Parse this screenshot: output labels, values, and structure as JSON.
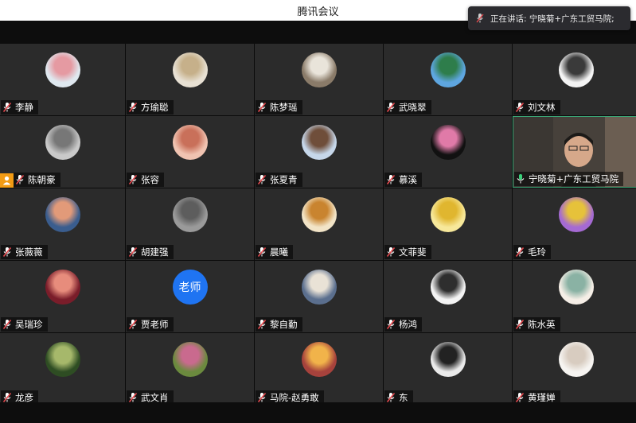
{
  "window": {
    "title": "腾讯会议"
  },
  "speaking": {
    "text": "正在讲话: 宁晓菊+广东工贸马院;"
  },
  "participants": [
    {
      "name": "李静",
      "avatar": "avatar-cartoon-girl-desk",
      "colors": [
        "#dfe8ef",
        "#e59aa2"
      ]
    },
    {
      "name": "方瑜聪",
      "avatar": "avatar-cartoon-drawing",
      "colors": [
        "#e7e0d3",
        "#c6b08a"
      ]
    },
    {
      "name": "陈梦瑶",
      "avatar": "avatar-mandala-pattern",
      "colors": [
        "#8a7b69",
        "#e9e4da"
      ]
    },
    {
      "name": "武晓翠",
      "avatar": "avatar-landscape-mountains",
      "colors": [
        "#5ea6e0",
        "#2e7d4b"
      ]
    },
    {
      "name": "刘文林",
      "avatar": "avatar-anime-girl",
      "colors": [
        "#f4f4f4",
        "#3a3a3a"
      ]
    },
    {
      "name": "陈朝豪",
      "avatar": "avatar-sketch-portrait",
      "colors": [
        "#c9c9c9",
        "#777777"
      ],
      "host": true
    },
    {
      "name": "张容",
      "avatar": "avatar-pink-cat",
      "colors": [
        "#f0c3b1",
        "#c9705a"
      ]
    },
    {
      "name": "张夏青",
      "avatar": "avatar-anime-girl-illustration",
      "colors": [
        "#c6d7ea",
        "#6f4e3a"
      ]
    },
    {
      "name": "慕溪",
      "avatar": "avatar-pink-flower",
      "colors": [
        "#111111",
        "#e07aa8"
      ]
    },
    {
      "name": "宁晓菊+广东工贸马院",
      "avatar": "video-feed",
      "speaking": true
    },
    {
      "name": "张薇薇",
      "avatar": "avatar-sunset-sea",
      "colors": [
        "#3a5d8e",
        "#e29a79"
      ]
    },
    {
      "name": "胡建强",
      "avatar": "avatar-desert-dunes",
      "colors": [
        "#9a9a9a",
        "#5d5d5d"
      ]
    },
    {
      "name": "晨曦",
      "avatar": "avatar-cartoon-tiger",
      "colors": [
        "#f2e4c7",
        "#c9842f"
      ]
    },
    {
      "name": "文菲斐",
      "avatar": "avatar-emoji-kids",
      "colors": [
        "#f7e89a",
        "#e0b62f"
      ]
    },
    {
      "name": "毛玲",
      "avatar": "avatar-colorful-portrait",
      "colors": [
        "#a56ad3",
        "#e6c23a"
      ]
    },
    {
      "name": "吴瑞珍",
      "avatar": "avatar-woman-flowers",
      "colors": [
        "#7a1d2a",
        "#e78c7c"
      ]
    },
    {
      "name": "贾老师",
      "avatar": "avatar-text",
      "initials": "老师",
      "colors": [
        "#1f74f2",
        "#ffffff"
      ]
    },
    {
      "name": "黎自勤",
      "avatar": "avatar-husky-dog",
      "colors": [
        "#5b6f8e",
        "#e9e2d6"
      ]
    },
    {
      "name": "杨鸿",
      "avatar": "avatar-cartoon-cat",
      "colors": [
        "#f3f3f3",
        "#2e2e2e"
      ]
    },
    {
      "name": "陈水英",
      "avatar": "avatar-anime-doll",
      "colors": [
        "#f5eee6",
        "#8ab2a4"
      ]
    },
    {
      "name": "龙彦",
      "avatar": "avatar-forest-path",
      "colors": [
        "#2e4d23",
        "#a6b86b"
      ]
    },
    {
      "name": "武文肖",
      "avatar": "avatar-garden-photo",
      "colors": [
        "#6b8a3e",
        "#c96a8e"
      ]
    },
    {
      "name": "马院-赵勇敢",
      "avatar": "avatar-game-character",
      "colors": [
        "#a6423c",
        "#f1b34a"
      ]
    },
    {
      "name": "东",
      "avatar": "avatar-black-horse",
      "colors": [
        "#eaeaea",
        "#222222"
      ]
    },
    {
      "name": "黄瑾婵",
      "avatar": "avatar-toy-bear",
      "colors": [
        "#f6f4f1",
        "#d8ccc0"
      ]
    }
  ]
}
